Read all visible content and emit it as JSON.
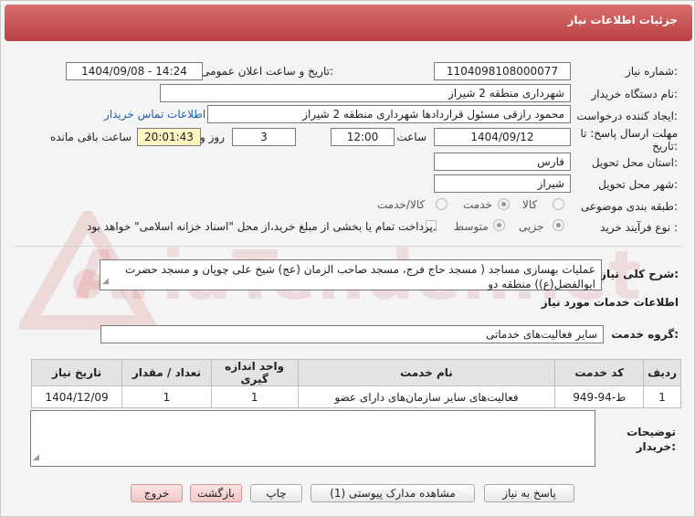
{
  "header": {
    "title": "جزئیات اطلاعات نیاز"
  },
  "watermark": {
    "text": "AriaTender.net"
  },
  "form": {
    "need_number_label": "شماره نیاز:",
    "need_number": "1104098108000077",
    "announce_label": "تاریخ و ساعت اعلان عمومی:",
    "announce_value": "1404/09/08 - 14:24",
    "buyer_org_label": "نام دستگاه خریدار:",
    "buyer_org": "شهرداری منطقه 2 شیراز",
    "creator_label": "ایجاد کننده درخواست:",
    "creator": "محمود رازقی مسئول قراردادها شهرداری منطقه 2 شیراز",
    "contact_link": "اطلاعات تماس خریدار",
    "deadline_label_1": "مهلت ارسال پاسخ: تا",
    "deadline_label_2": "تاریخ:",
    "deadline_date": "1404/09/12",
    "time_label": "ساعت",
    "deadline_time": "12:00",
    "days_value": "3",
    "days_label": "روز و",
    "remaining_time": "20:01:43",
    "remaining_label": "ساعت باقی مانده",
    "province_label": "استان محل تحویل:",
    "province": "فارس",
    "city_label": "شهر محل تحویل:",
    "city": "شیراز",
    "category_label": "طبقه بندی موضوعی:",
    "category_options": [
      "کالا",
      "خدمت",
      "کالا/خدمت"
    ],
    "category_selected": "خدمت",
    "process_label": "نوع فرآیند خرید :",
    "process_options": [
      "جزیی",
      "متوسط"
    ],
    "process_selected": "جزیی",
    "payment_note": "پرداخت تمام یا بخشی از مبلغ خرید،از محل \"اسناد خزانه اسلامی\" خواهد بود."
  },
  "summary": {
    "label": "شرح کلی نیاز:",
    "text": "عملیات بهسازی مساجد ( مسجد حاج فرج، مسجد صاحب الزمان (عج) شیخ علی چوپان و مسجد حضرت ابوالفضل(ع)) منطقه دو"
  },
  "services": {
    "section_title": "اطلاعات خدمات مورد نیاز",
    "group_label": "گروه خدمت:",
    "group_value": "سایر فعالیت‌های خدماتی",
    "columns": [
      "ردیف",
      "کد خدمت",
      "نام خدمت",
      "واحد اندازه گیری",
      "تعداد / مقدار",
      "تاریخ نیاز"
    ],
    "rows": [
      {
        "row": "1",
        "code": "ط-94-949",
        "name": "فعالیت‌های سایر سازمان‌های دارای عضو",
        "unit": "1",
        "qty": "1",
        "date": "1404/12/09"
      }
    ]
  },
  "notes": {
    "label_1": "توضیحات",
    "label_2": "خریدار:",
    "value": ""
  },
  "buttons": {
    "reply": "پاسخ به نیاز",
    "attachments": "مشاهده مدارک پیوستی (1)",
    "print": "چاپ",
    "back": "بازگشت",
    "exit": "خروج"
  },
  "colors": {
    "title_bar": "#c65151",
    "link": "#1a5fb4",
    "highlight": "#fdf6c3"
  }
}
